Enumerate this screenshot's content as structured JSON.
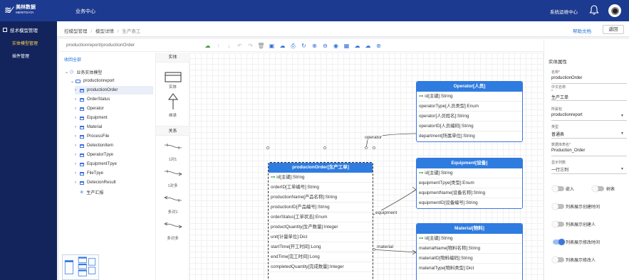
{
  "topbar": {
    "logo_cn": "美林数据",
    "logo_en": "MERITDATA",
    "app_title": "业务中心",
    "system_link": "系统运维中心"
  },
  "leftnav": {
    "group": "技术模型管理",
    "items": [
      {
        "label": "实体模型管理",
        "active": true
      },
      {
        "label": "插件管理",
        "active": false
      }
    ]
  },
  "breadcrumb": {
    "items": [
      "控模型管理",
      "模型详情",
      "生产表工"
    ],
    "help": "帮助文档",
    "back": "返回"
  },
  "path": {
    "text": "productionreport/productionOrder"
  },
  "toolbar": {
    "icons": [
      "cloud-save-icon",
      "arrow-up-icon",
      "arrow-down-icon",
      "undo-icon",
      "redo-icon",
      "delete-icon",
      "save-icon",
      "download-cloud-icon",
      "print-icon",
      "refresh-icon",
      "zoom-in-icon",
      "zoom-out-icon",
      "eye-icon",
      "image-icon",
      "upload-cloud-icon",
      "export-icon",
      "share-icon"
    ]
  },
  "tree": {
    "collapse_all": "收回全部",
    "root": "业务实体模型",
    "folder": "productionreport",
    "items": [
      "productionOrder",
      "OrderStatus",
      "Operator",
      "Equipment",
      "Material",
      "ProcessFile",
      "DetectionItem",
      "OperatorTpye",
      "EquipmentTpye",
      "FileTpye",
      "DetecionResult"
    ],
    "leaf": "生产汇报",
    "selected": "productionOrder"
  },
  "shapes": {
    "entity_header": "实体",
    "entity_label": "实体",
    "inherit_label": "继承",
    "relation_header": "关系",
    "one_to_one": "1对1",
    "one_to_many": "1对多",
    "many_to_one": "多对1",
    "many_to_many": "多对多"
  },
  "entities": {
    "operator": {
      "title": "Operator[人员]",
      "fields": [
        "id[主键]:String",
        "operatorType[人员类型]:Enum",
        "operator[人员姓名]:String",
        "operatorID[人员编码]:String",
        "department[所属单位]:String"
      ]
    },
    "equipment": {
      "title": "Equipment[设备]",
      "fields": [
        "id[主键]:String",
        "equipmentTpye[类型]:Enum",
        "equipmentName[设备名称]:String",
        "equipmentID[设备编号]:String"
      ]
    },
    "material": {
      "title": "Material[物料]",
      "fields": [
        "id[主键]:String",
        "materialName[物料名称]:String",
        "materialID[物料编码]:String",
        "materialType[物料类型]:Dict"
      ]
    },
    "order": {
      "title": "producionOrder[生产工单]",
      "fields": [
        "id[主键]:String",
        "orderID[工单编号]:String",
        "productionName[产品名称]:String",
        "productionID[产品编号]:String",
        "orderStatus[工单状态]:Enum",
        "productQuantity[生产数量]:Integer",
        "unit[计量单位]:Dict",
        "startTime[开工时间]:Long",
        "endTime[完工时间]:Long",
        "completedQuantity[完成数量]:Integer"
      ]
    }
  },
  "edges": {
    "operator": "operator",
    "equipment": "equipment",
    "material": "material"
  },
  "props": {
    "title": "实体属性",
    "name_label": "名称",
    "name_value": "productionOrder",
    "cn_label": "中文名称",
    "cn_value": "生产工单",
    "belong_label": "所属包",
    "belong_value": "productionreport",
    "type_label": "类型",
    "type_value": "普通表",
    "table_label": "数据库表名",
    "table_value": "Production_Order",
    "display_label": "显示列数",
    "display_value": "一行三列",
    "embed": "嵌入",
    "tree": "树表",
    "toggles": [
      {
        "label": "列表展示创建时间",
        "on": false
      },
      {
        "label": "列表展示创建人",
        "on": false
      },
      {
        "label": "列表展示修改时间",
        "on": true
      },
      {
        "label": "列表展示修改人",
        "on": false
      }
    ]
  }
}
